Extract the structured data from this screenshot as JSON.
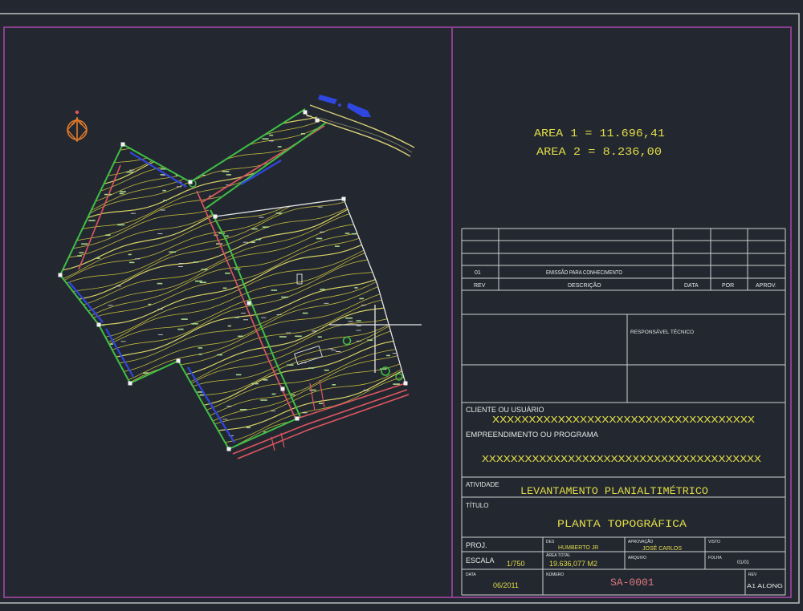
{
  "colors": {
    "background": "#232830",
    "frame": "#8b3f8f",
    "border": "#bdbdbd",
    "text_white": "#e6e6e6",
    "text_yellow": "#e2dc48",
    "number_red": "#e07880",
    "boundary_green": "#3fbf45",
    "boundary_blue": "#3046e0",
    "boundary_red": "#e05560",
    "contour_yellow": "#d2c63c"
  },
  "icons": {
    "north_arrow": "north-arrow-icon"
  },
  "areas": {
    "area1": "AREA 1 = 11.696,41",
    "area2": "AREA 2 = 8.236,00"
  },
  "revision_table": {
    "rows": [
      {
        "rev": "01",
        "description": "EMISSÃO PARA CONHECIMENTO"
      }
    ],
    "headers": {
      "rev": "REV",
      "description": "DESCRIÇÃO",
      "date": "DATA",
      "by": "POR",
      "approved": "APROV."
    }
  },
  "responsible": {
    "label": "RESPONSÁVEL TÉCNICO"
  },
  "client": {
    "label": "CLIENTE OU USUÁRIO",
    "value": "XXXXXXXXXXXXXXXXXXXXXXXXXXXXXXXXXXXX"
  },
  "enterprise": {
    "label": "EMPREENDIMENTO OU PROGRAMA",
    "value": "XXXXXXXXXXXXXXXXXXXXXXXXXXXXXXXXXXXXXXX"
  },
  "activity": {
    "label": "ATIVIDADE",
    "value": "LEVANTAMENTO PLANIALTIMÉTRICO"
  },
  "title": {
    "label": "TÍTULO",
    "value": "PLANTA TOPOGRÁFICA"
  },
  "info": {
    "proj_label": "PROJ.",
    "scale_label": "ESCALA",
    "scale": "1/750",
    "date_label": "DATA",
    "date": "06/2011",
    "designer_label": "DES",
    "designer": "HUMBERTO JR",
    "area_label": "ÁREA TOTAL",
    "area": "19.636,077 M2",
    "number_label": "NÚMERO",
    "number": "SA-0001",
    "approval_label": "APROVAÇÃO",
    "approver": "JOSÉ CARLOS",
    "check_label": "VISTO",
    "file_label": "ARQUIVO",
    "sheet_label": "FOLHA",
    "sheet": "01/01",
    "rev_label": "REV",
    "format": "A1 ALONG"
  }
}
